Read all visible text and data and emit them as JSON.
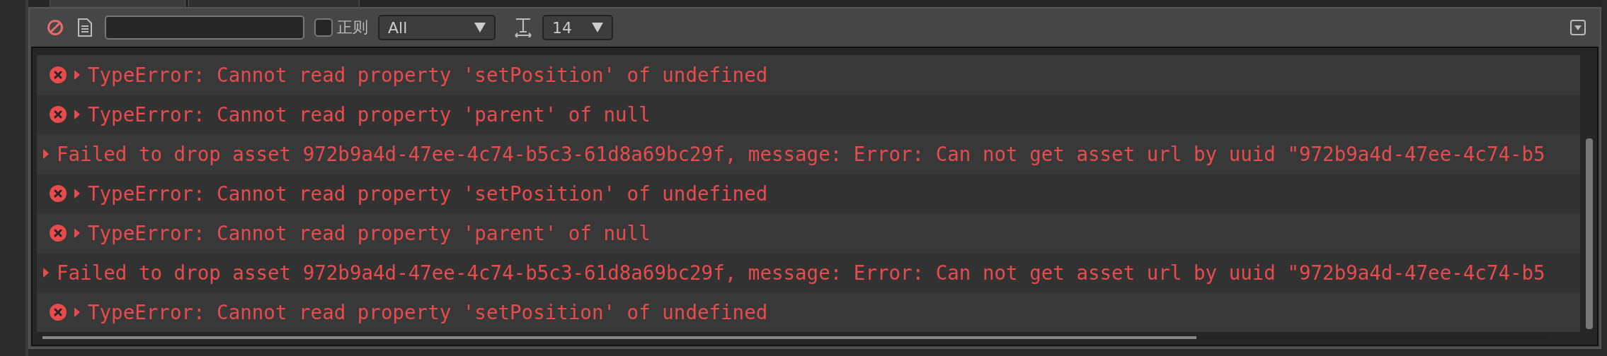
{
  "toolbar": {
    "regex": {
      "label": "正则",
      "checked": false
    },
    "level_filter": {
      "value": "All"
    },
    "font_size": {
      "value": "14"
    }
  },
  "log": [
    {
      "kind": "error",
      "text": "TypeError: Cannot read property 'setPosition' of undefined"
    },
    {
      "kind": "error",
      "text": "TypeError: Cannot read property 'parent' of null"
    },
    {
      "kind": "plain",
      "text": "Failed to drop asset 972b9a4d-47ee-4c74-b5c3-61d8a69bc29f, message: Error: Can not get asset url by uuid \"972b9a4d-47ee-4c74-b5"
    },
    {
      "kind": "error",
      "text": "TypeError: Cannot read property 'setPosition' of undefined"
    },
    {
      "kind": "error",
      "text": "TypeError: Cannot read property 'parent' of null"
    },
    {
      "kind": "plain",
      "text": "Failed to drop asset 972b9a4d-47ee-4c74-b5c3-61d8a69bc29f, message: Error: Can not get asset url by uuid \"972b9a4d-47ee-4c74-b5"
    },
    {
      "kind": "error",
      "text": "TypeError: Cannot read property 'setPosition' of undefined"
    }
  ]
}
